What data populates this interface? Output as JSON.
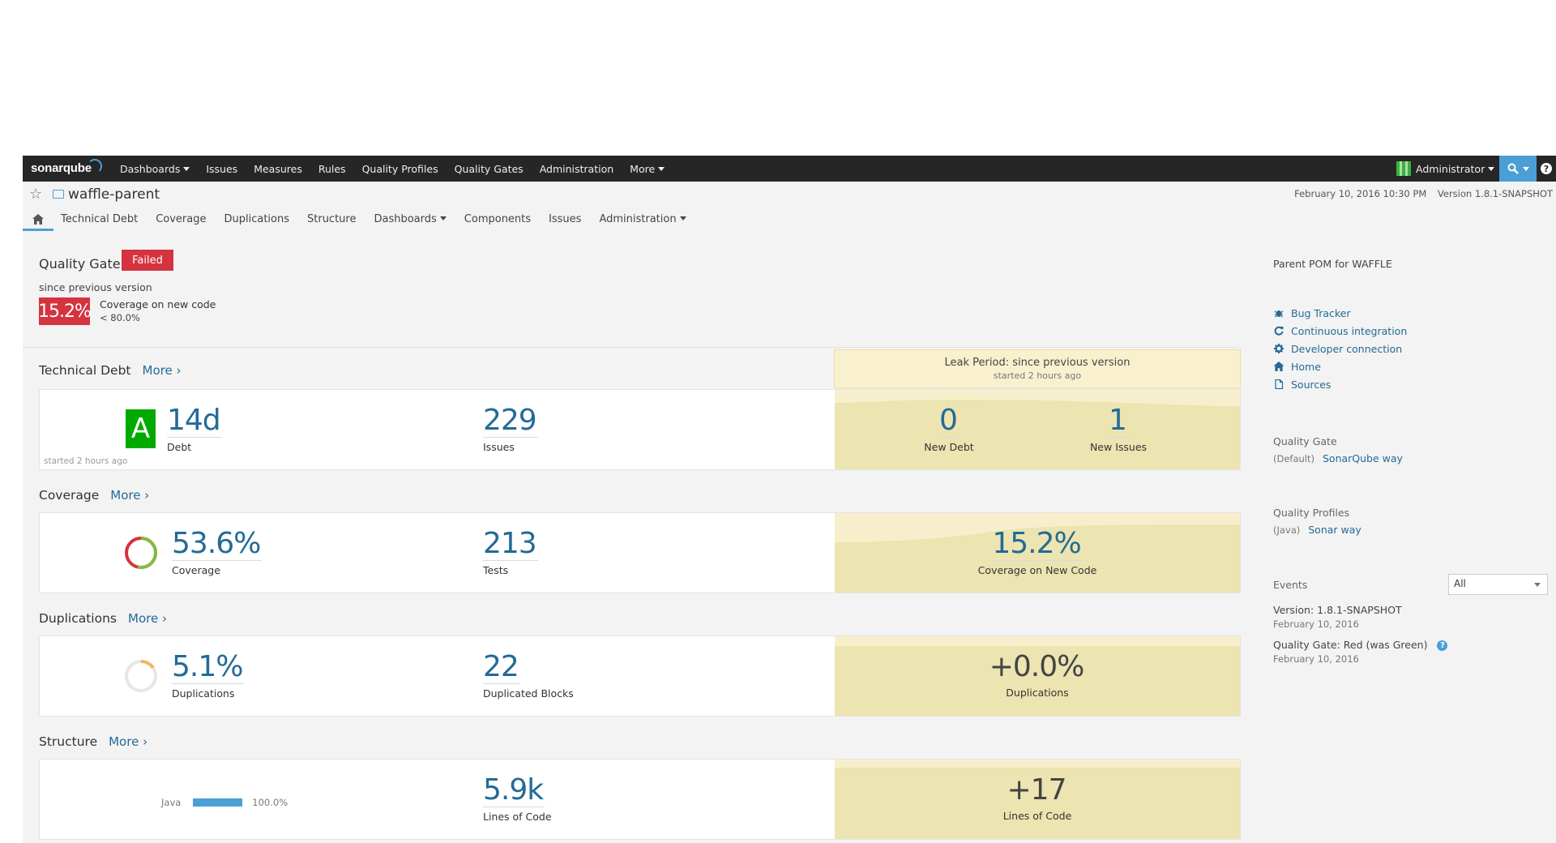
{
  "nav": {
    "logo": "sonarqube",
    "items": [
      {
        "label": "Dashboards",
        "caret": true
      },
      {
        "label": "Issues",
        "caret": false
      },
      {
        "label": "Measures",
        "caret": false
      },
      {
        "label": "Rules",
        "caret": false
      },
      {
        "label": "Quality Profiles",
        "caret": false
      },
      {
        "label": "Quality Gates",
        "caret": false
      },
      {
        "label": "Administration",
        "caret": false
      },
      {
        "label": "More",
        "caret": true
      }
    ],
    "user": "Administrator",
    "help": "?"
  },
  "project": {
    "name": "waffle-parent",
    "date": "February 10, 2016 10:30 PM",
    "version": "Version 1.8.1-SNAPSHOT"
  },
  "subnav": [
    "Technical Debt",
    "Coverage",
    "Duplications",
    "Structure",
    "Dashboards",
    "Components",
    "Issues",
    "Administration"
  ],
  "quality_gate": {
    "title": "Quality Gate",
    "status": "Failed",
    "since": "since previous version",
    "value": "15.2%",
    "metric": "Coverage on new code",
    "threshold": "< 80.0%"
  },
  "leak": {
    "title": "Leak Period: since previous version",
    "started": "started 2 hours ago"
  },
  "more_label": "More ›",
  "tech_debt": {
    "title": "Technical Debt",
    "rating": "A",
    "debt_value": "14d",
    "debt_label": "Debt",
    "started": "started 2 hours ago",
    "issues_value": "229",
    "issues_label": "Issues",
    "new_debt_value": "0",
    "new_debt_label": "New Debt",
    "new_issues_value": "1",
    "new_issues_label": "New Issues"
  },
  "coverage": {
    "title": "Coverage",
    "value": "53.6%",
    "label": "Coverage",
    "tests_value": "213",
    "tests_label": "Tests",
    "new_value": "15.2%",
    "new_label": "Coverage on New Code",
    "fraction": 0.536
  },
  "duplications": {
    "title": "Duplications",
    "value": "5.1%",
    "label": "Duplications",
    "blocks_value": "22",
    "blocks_label": "Duplicated Blocks",
    "new_value": "+0.0%",
    "new_label": "Duplications",
    "fraction": 0.051
  },
  "structure": {
    "title": "Structure",
    "lang": "Java",
    "lang_pct": "100.0%",
    "loc_value": "5.9k",
    "loc_label": "Lines of Code",
    "new_value": "+17",
    "new_label": "Lines of Code"
  },
  "side": {
    "description": "Parent POM for WAFFLE",
    "links": [
      {
        "icon": "bug-icon",
        "label": "Bug Tracker"
      },
      {
        "icon": "refresh-icon",
        "label": "Continuous integration"
      },
      {
        "icon": "gear-icon",
        "label": "Developer connection"
      },
      {
        "icon": "home-icon",
        "label": "Home"
      },
      {
        "icon": "file-icon",
        "label": "Sources"
      }
    ],
    "qg_label": "Quality Gate",
    "qg_default": "(Default)",
    "qg_link": "SonarQube way",
    "qp_label": "Quality Profiles",
    "qp_lang": "(Java)",
    "qp_link": "Sonar way",
    "events_label": "Events",
    "events_filter": "All",
    "events": [
      {
        "title": "Version: 1.8.1-SNAPSHOT",
        "date": "February 10, 2016",
        "help": false
      },
      {
        "title": "Quality Gate: Red (was Green)",
        "date": "February 10, 2016",
        "help": true
      }
    ]
  },
  "colors": {
    "accent": "#4b9fd5",
    "error": "#d4333f",
    "rating_a": "#00aa00",
    "leak_bg": "#ece4b1",
    "link": "#236a97"
  }
}
